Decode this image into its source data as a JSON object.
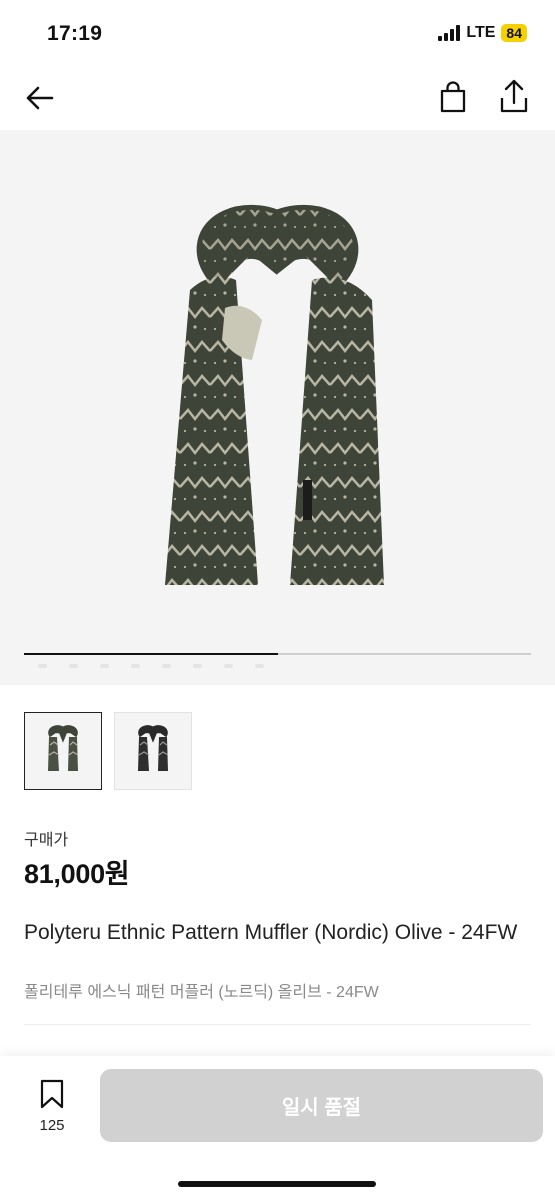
{
  "status_bar": {
    "time": "17:19",
    "network": "LTE",
    "battery": "84"
  },
  "icons": {
    "back": "back-arrow-icon",
    "bag": "shopping-bag-icon",
    "share": "share-icon",
    "bookmark": "bookmark-icon"
  },
  "gallery": {
    "progress": 0.5,
    "thumbnails": [
      "olive scarf thumbnail",
      "charcoal scarf thumbnail"
    ]
  },
  "product": {
    "price_label": "구매가",
    "price": "81,000원",
    "name_en": "Polyteru Ethnic Pattern Muffler (Nordic) Olive - 24FW",
    "name_ko": "폴리테루 에스닉 패턴 머플러 (노르딕) 올리브 - 24FW"
  },
  "bottom_bar": {
    "bookmark_count": "125",
    "button_label": "일시 품절"
  },
  "colors": {
    "accent_disabled": "#d1d1d1",
    "battery": "#f5d100",
    "scarf_olive": "#3e4437",
    "scarf_pattern": "#b7b5a3"
  }
}
